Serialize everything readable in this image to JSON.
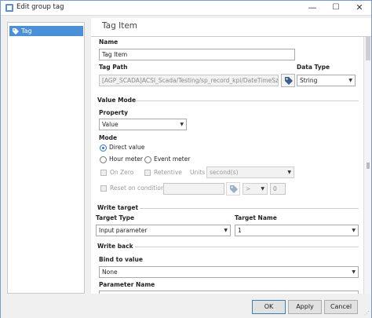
{
  "window": {
    "title": "Edit group tag",
    "minimize": "—",
    "maximize": "☐",
    "close": "✕"
  },
  "sidebar": {
    "items": [
      {
        "label": "Tag",
        "icon": "tag-icon"
      }
    ]
  },
  "header": {
    "title": "Tag Item"
  },
  "form": {
    "name_label": "Name",
    "name_value": "Tag Item",
    "tag_path_label": "Tag Path",
    "tag_path_value": "[AGP_SCADA]ACSI_Scada/Testing/sp_record_kpi/DateTimeSz",
    "data_type_label": "Data Type",
    "data_type_value": "String",
    "value_mode_section": "Value Mode",
    "property_label": "Property",
    "property_value": "Value",
    "mode_label": "Mode",
    "mode_direct": "Direct value",
    "mode_hour": "Hour meter",
    "mode_event": "Event meter",
    "on_zero": "On Zero",
    "retentive": "Retentive",
    "units_label": "Units",
    "units_value": "second(s)",
    "reset_on_condition": "Reset on condition:",
    "reset_op_value": ">",
    "reset_num_value": "0",
    "write_target_section": "Write target",
    "target_type_label": "Target Type",
    "target_type_value": "Input parameter",
    "target_name_label": "Target Name",
    "target_name_value": "1",
    "write_back_section": "Write back",
    "bind_to_value_label": "Bind to value",
    "bind_to_value_value": "None",
    "parameter_name_label": "Parameter Name"
  },
  "footer": {
    "ok": "OK",
    "apply": "Apply",
    "cancel": "Cancel"
  },
  "colors": {
    "selection": "#4a90d9",
    "radio_accent": "#2a75d0"
  }
}
